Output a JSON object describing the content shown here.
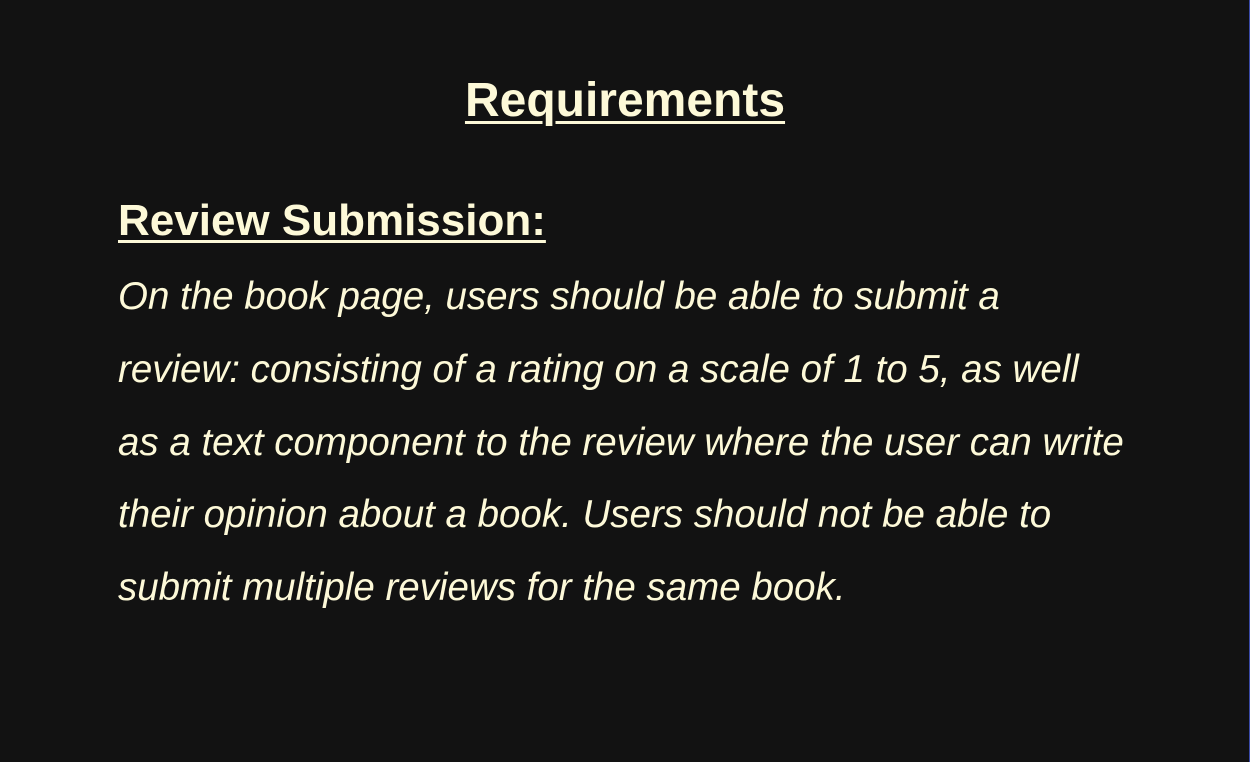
{
  "page": {
    "title": "Requirements",
    "section_heading": "Review Submission:",
    "body": "On the book page, users should be able to submit a review: consisting of a rating on a scale of 1 to 5, as well as a text component to the review where the user can write their opinion about a book. Users should not be able to submit multiple reviews for the same book."
  },
  "colors": {
    "background": "#121212",
    "text": "#fdf9d8",
    "edge_accent": "#3a4aa8"
  }
}
